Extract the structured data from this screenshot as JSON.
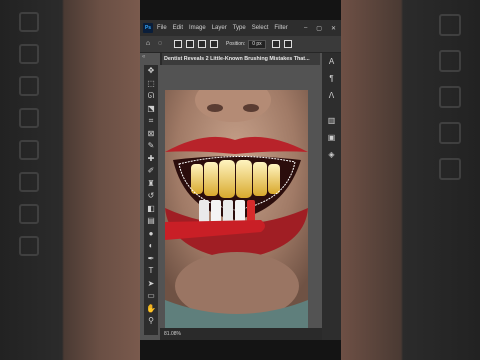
{
  "app": {
    "logo_text": "Ps"
  },
  "menu": [
    "File",
    "Edit",
    "Image",
    "Layer",
    "Type",
    "Select",
    "Filter"
  ],
  "window_controls": {
    "minimize": "–",
    "maximize": "▢",
    "close": "✕"
  },
  "options_bar": {
    "position_label": "Position:",
    "position_value": "0 px"
  },
  "document": {
    "tab_title": "Dentist Reveals 2 Little-Known Brushing Mistakes That..."
  },
  "panel_toggles": {
    "left": "«",
    "right": "»"
  },
  "status": {
    "zoom": "81.08%"
  },
  "tools": [
    {
      "name": "move-tool-icon",
      "glyph": "✥"
    },
    {
      "name": "marquee-tool-icon",
      "glyph": "⬚"
    },
    {
      "name": "lasso-tool-icon",
      "glyph": "ᘏ"
    },
    {
      "name": "object-select-tool-icon",
      "glyph": "⬔"
    },
    {
      "name": "crop-tool-icon",
      "glyph": "⌗"
    },
    {
      "name": "frame-tool-icon",
      "glyph": "⊠"
    },
    {
      "name": "eyedropper-tool-icon",
      "glyph": "✎"
    },
    {
      "name": "healing-brush-icon",
      "glyph": "✚"
    },
    {
      "name": "brush-tool-icon",
      "glyph": "✐"
    },
    {
      "name": "clone-stamp-icon",
      "glyph": "♜"
    },
    {
      "name": "history-brush-icon",
      "glyph": "↺"
    },
    {
      "name": "eraser-tool-icon",
      "glyph": "◧"
    },
    {
      "name": "gradient-tool-icon",
      "glyph": "▤"
    },
    {
      "name": "blur-tool-icon",
      "glyph": "●"
    },
    {
      "name": "dodge-tool-icon",
      "glyph": "◐"
    },
    {
      "name": "pen-tool-icon",
      "glyph": "✒"
    },
    {
      "name": "type-tool-icon",
      "glyph": "T"
    },
    {
      "name": "path-select-icon",
      "glyph": "➤"
    },
    {
      "name": "shape-tool-icon",
      "glyph": "▭"
    },
    {
      "name": "hand-tool-icon",
      "glyph": "✋"
    },
    {
      "name": "zoom-tool-icon",
      "glyph": "⚲"
    }
  ],
  "right_panel_icons": [
    {
      "name": "character-panel-icon",
      "glyph": "A"
    },
    {
      "name": "paragraph-panel-icon",
      "glyph": "¶"
    },
    {
      "name": "glyphs-panel-icon",
      "glyph": "ꓥ"
    },
    {
      "name": "libraries-panel-icon",
      "glyph": "▥"
    },
    {
      "name": "properties-panel-icon",
      "glyph": "▣"
    },
    {
      "name": "layers-panel-icon",
      "glyph": "◈"
    }
  ]
}
